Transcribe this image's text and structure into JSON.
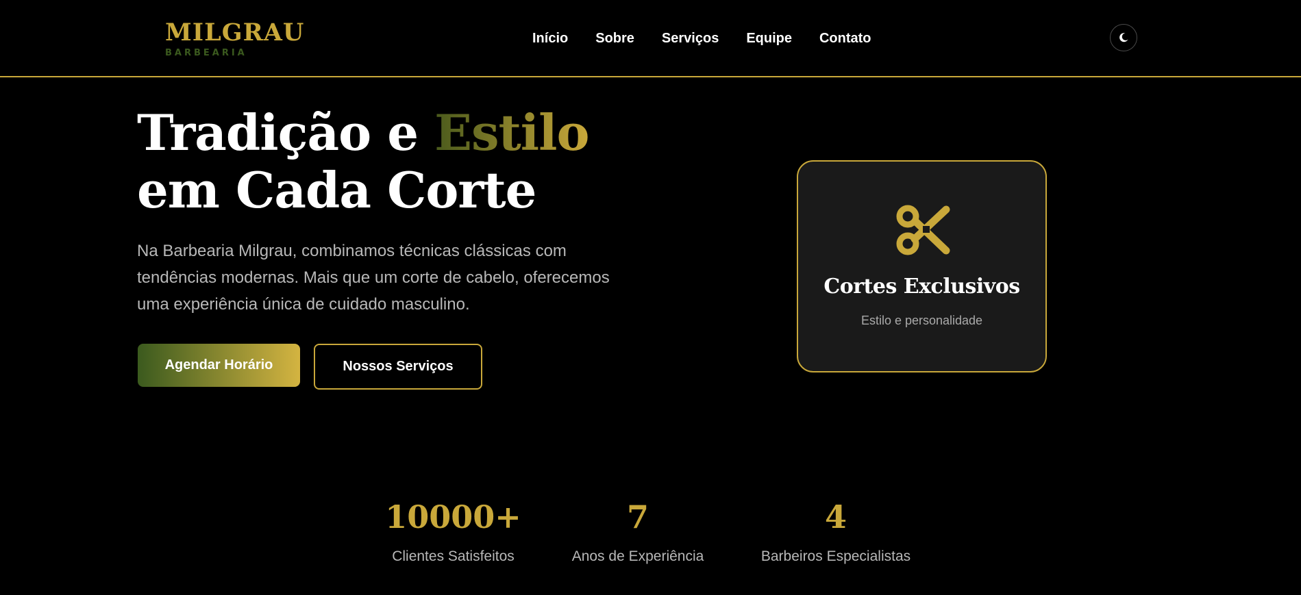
{
  "brand": {
    "name": "MILGRAU",
    "tagline": "BARBEARIA"
  },
  "nav": {
    "items": [
      "Início",
      "Sobre",
      "Serviços",
      "Equipe",
      "Contato"
    ]
  },
  "theme_toggle": {
    "icon": "moon-icon"
  },
  "hero": {
    "title_part1": "Tradição e ",
    "title_accent": "Estilo",
    "title_part2": " em Cada Corte",
    "description": "Na Barbearia Milgrau, combinamos técnicas clássicas com tendências modernas. Mais que um corte de cabelo, oferecemos uma experiência única de cuidado masculino.",
    "primary_button": "Agendar Horário",
    "secondary_button": "Nossos Serviços"
  },
  "feature_card": {
    "icon": "scissors-icon",
    "title": "Cortes Exclusivos",
    "subtitle": "Estilo e personalidade"
  },
  "stats": [
    {
      "value": "10000+",
      "label": "Clientes Satisfeitos"
    },
    {
      "value": "7",
      "label": "Anos de Experiência"
    },
    {
      "value": "4",
      "label": "Barbeiros Especialistas"
    }
  ],
  "colors": {
    "gold": "#c9a83a",
    "olive": "#3b5a1e",
    "background": "#000000",
    "card": "#1a1a1a"
  }
}
